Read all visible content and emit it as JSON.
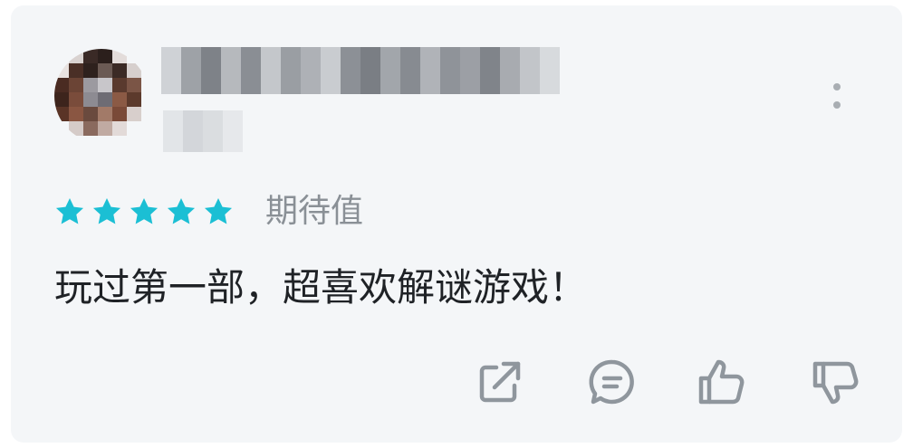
{
  "review": {
    "rating_stars": 5,
    "rating_max": 5,
    "rating_label": "期待值",
    "text": "玩过第一部，超喜欢解谜游戏！"
  },
  "icons": {
    "more": "more-vertical-icon",
    "share": "share-icon",
    "comment": "comment-icon",
    "like": "thumbs-up-icon",
    "dislike": "thumbs-down-icon",
    "star": "star-icon"
  },
  "colors": {
    "star": "#1bbfd4",
    "icon": "#8f969d",
    "card_bg": "#f4f6f8",
    "text": "#1f2226",
    "label": "#8a9096"
  }
}
